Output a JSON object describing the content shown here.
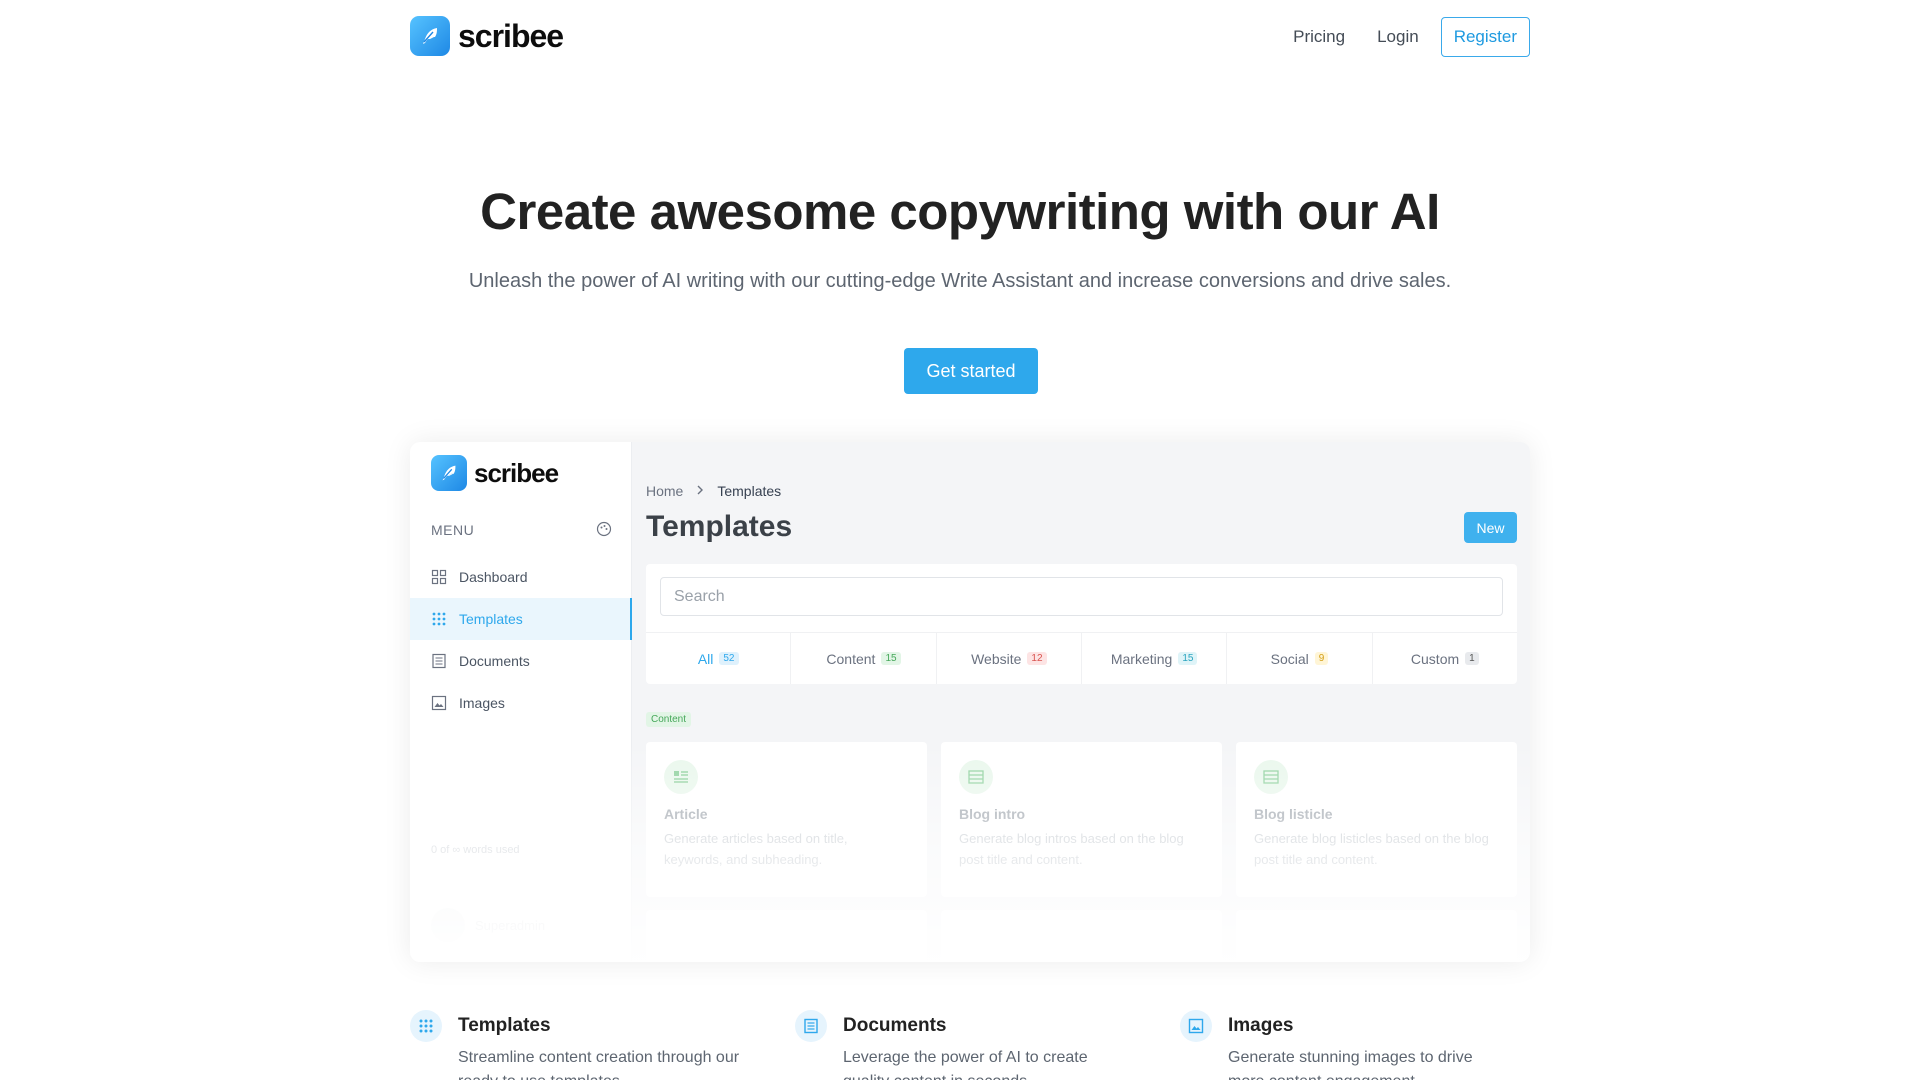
{
  "brand": {
    "name": "scribee",
    "logo_icon": "feather-icon",
    "accent": "#2ea8ec"
  },
  "nav": {
    "pricing": "Pricing",
    "login": "Login",
    "register": "Register"
  },
  "hero": {
    "title": "Create awesome copywriting with our AI",
    "subtitle": "Unleash the power of AI writing with our cutting-edge Write Assistant and increase conversions and drive sales.",
    "cta": "Get started"
  },
  "preview": {
    "brand": "scribee",
    "menu_label": "MENU",
    "menu_items": [
      {
        "label": "Dashboard",
        "icon": "dashboard-icon"
      },
      {
        "label": "Templates",
        "icon": "grid-icon",
        "active": true
      },
      {
        "label": "Documents",
        "icon": "document-icon"
      },
      {
        "label": "Images",
        "icon": "image-icon"
      }
    ],
    "usage": "0 of ∞ words used",
    "user_name": "Superadmin",
    "breadcrumb": {
      "home": "Home",
      "current": "Templates"
    },
    "page_title": "Templates",
    "new_button": "New",
    "search_placeholder": "Search",
    "tabs": [
      {
        "label": "All",
        "count": "52"
      },
      {
        "label": "Content",
        "count": "15"
      },
      {
        "label": "Website",
        "count": "12"
      },
      {
        "label": "Marketing",
        "count": "15"
      },
      {
        "label": "Social",
        "count": "9"
      },
      {
        "label": "Custom",
        "count": "1"
      }
    ],
    "section_badge": "Content",
    "cards": [
      {
        "name": "Article",
        "desc": "Generate articles based on title, keywords, and subheading."
      },
      {
        "name": "Blog intro",
        "desc": "Generate blog intros based on the blog post title and content."
      },
      {
        "name": "Blog listicle",
        "desc": "Generate blog listicles based on the blog post title and content."
      }
    ]
  },
  "features": [
    {
      "title": "Templates",
      "desc": "Streamline content creation through our ready to use templates.",
      "icon": "grid-icon"
    },
    {
      "title": "Documents",
      "desc": "Leverage the power of AI to create quality content in seconds.",
      "icon": "document-icon"
    },
    {
      "title": "Images",
      "desc": "Generate stunning images to drive more content engagement.",
      "icon": "image-icon"
    }
  ]
}
